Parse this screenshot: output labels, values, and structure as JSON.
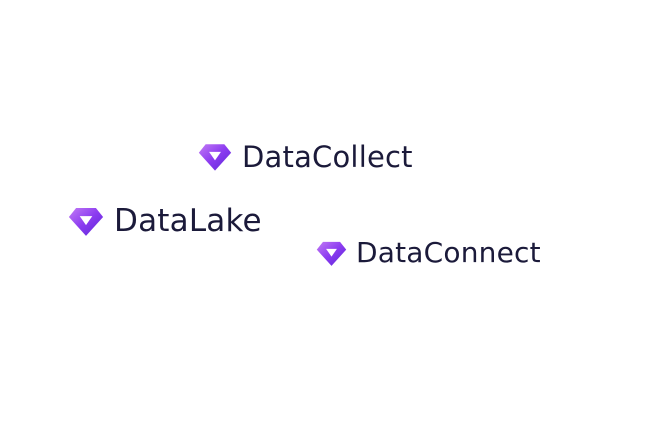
{
  "colors": {
    "background": "#ffffff",
    "wordmark": "#1b1a3a",
    "gem_light": "#c27bf5",
    "gem_mid": "#8b3bf0",
    "gem_dark": "#5b27d6"
  },
  "logos": [
    {
      "icon": "diamond-gem-icon",
      "name": "DataCollect"
    },
    {
      "icon": "diamond-gem-icon",
      "name": "DataLake"
    },
    {
      "icon": "diamond-gem-icon",
      "name": "DataConnect"
    }
  ]
}
